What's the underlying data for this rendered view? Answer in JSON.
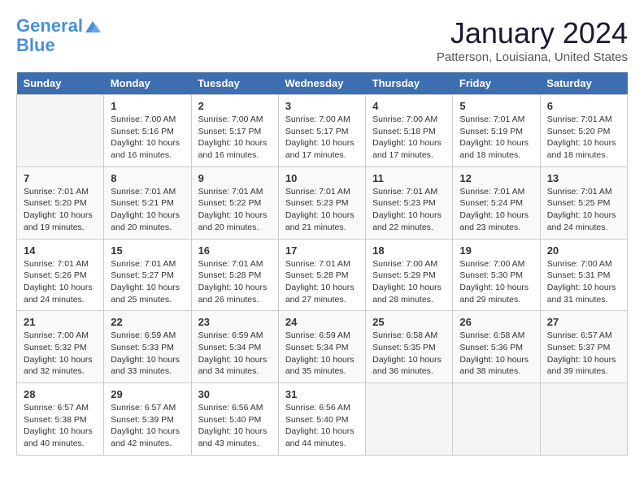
{
  "header": {
    "logo_line1": "General",
    "logo_line2": "Blue",
    "month_title": "January 2024",
    "location": "Patterson, Louisiana, United States"
  },
  "weekdays": [
    "Sunday",
    "Monday",
    "Tuesday",
    "Wednesday",
    "Thursday",
    "Friday",
    "Saturday"
  ],
  "weeks": [
    [
      {
        "day": "",
        "content": ""
      },
      {
        "day": "1",
        "content": "Sunrise: 7:00 AM\nSunset: 5:16 PM\nDaylight: 10 hours\nand 16 minutes."
      },
      {
        "day": "2",
        "content": "Sunrise: 7:00 AM\nSunset: 5:17 PM\nDaylight: 10 hours\nand 16 minutes."
      },
      {
        "day": "3",
        "content": "Sunrise: 7:00 AM\nSunset: 5:17 PM\nDaylight: 10 hours\nand 17 minutes."
      },
      {
        "day": "4",
        "content": "Sunrise: 7:00 AM\nSunset: 5:18 PM\nDaylight: 10 hours\nand 17 minutes."
      },
      {
        "day": "5",
        "content": "Sunrise: 7:01 AM\nSunset: 5:19 PM\nDaylight: 10 hours\nand 18 minutes."
      },
      {
        "day": "6",
        "content": "Sunrise: 7:01 AM\nSunset: 5:20 PM\nDaylight: 10 hours\nand 18 minutes."
      }
    ],
    [
      {
        "day": "7",
        "content": "Sunrise: 7:01 AM\nSunset: 5:20 PM\nDaylight: 10 hours\nand 19 minutes."
      },
      {
        "day": "8",
        "content": "Sunrise: 7:01 AM\nSunset: 5:21 PM\nDaylight: 10 hours\nand 20 minutes."
      },
      {
        "day": "9",
        "content": "Sunrise: 7:01 AM\nSunset: 5:22 PM\nDaylight: 10 hours\nand 20 minutes."
      },
      {
        "day": "10",
        "content": "Sunrise: 7:01 AM\nSunset: 5:23 PM\nDaylight: 10 hours\nand 21 minutes."
      },
      {
        "day": "11",
        "content": "Sunrise: 7:01 AM\nSunset: 5:23 PM\nDaylight: 10 hours\nand 22 minutes."
      },
      {
        "day": "12",
        "content": "Sunrise: 7:01 AM\nSunset: 5:24 PM\nDaylight: 10 hours\nand 23 minutes."
      },
      {
        "day": "13",
        "content": "Sunrise: 7:01 AM\nSunset: 5:25 PM\nDaylight: 10 hours\nand 24 minutes."
      }
    ],
    [
      {
        "day": "14",
        "content": "Sunrise: 7:01 AM\nSunset: 5:26 PM\nDaylight: 10 hours\nand 24 minutes."
      },
      {
        "day": "15",
        "content": "Sunrise: 7:01 AM\nSunset: 5:27 PM\nDaylight: 10 hours\nand 25 minutes."
      },
      {
        "day": "16",
        "content": "Sunrise: 7:01 AM\nSunset: 5:28 PM\nDaylight: 10 hours\nand 26 minutes."
      },
      {
        "day": "17",
        "content": "Sunrise: 7:01 AM\nSunset: 5:28 PM\nDaylight: 10 hours\nand 27 minutes."
      },
      {
        "day": "18",
        "content": "Sunrise: 7:00 AM\nSunset: 5:29 PM\nDaylight: 10 hours\nand 28 minutes."
      },
      {
        "day": "19",
        "content": "Sunrise: 7:00 AM\nSunset: 5:30 PM\nDaylight: 10 hours\nand 29 minutes."
      },
      {
        "day": "20",
        "content": "Sunrise: 7:00 AM\nSunset: 5:31 PM\nDaylight: 10 hours\nand 31 minutes."
      }
    ],
    [
      {
        "day": "21",
        "content": "Sunrise: 7:00 AM\nSunset: 5:32 PM\nDaylight: 10 hours\nand 32 minutes."
      },
      {
        "day": "22",
        "content": "Sunrise: 6:59 AM\nSunset: 5:33 PM\nDaylight: 10 hours\nand 33 minutes."
      },
      {
        "day": "23",
        "content": "Sunrise: 6:59 AM\nSunset: 5:34 PM\nDaylight: 10 hours\nand 34 minutes."
      },
      {
        "day": "24",
        "content": "Sunrise: 6:59 AM\nSunset: 5:34 PM\nDaylight: 10 hours\nand 35 minutes."
      },
      {
        "day": "25",
        "content": "Sunrise: 6:58 AM\nSunset: 5:35 PM\nDaylight: 10 hours\nand 36 minutes."
      },
      {
        "day": "26",
        "content": "Sunrise: 6:58 AM\nSunset: 5:36 PM\nDaylight: 10 hours\nand 38 minutes."
      },
      {
        "day": "27",
        "content": "Sunrise: 6:57 AM\nSunset: 5:37 PM\nDaylight: 10 hours\nand 39 minutes."
      }
    ],
    [
      {
        "day": "28",
        "content": "Sunrise: 6:57 AM\nSunset: 5:38 PM\nDaylight: 10 hours\nand 40 minutes."
      },
      {
        "day": "29",
        "content": "Sunrise: 6:57 AM\nSunset: 5:39 PM\nDaylight: 10 hours\nand 42 minutes."
      },
      {
        "day": "30",
        "content": "Sunrise: 6:56 AM\nSunset: 5:40 PM\nDaylight: 10 hours\nand 43 minutes."
      },
      {
        "day": "31",
        "content": "Sunrise: 6:56 AM\nSunset: 5:40 PM\nDaylight: 10 hours\nand 44 minutes."
      },
      {
        "day": "",
        "content": ""
      },
      {
        "day": "",
        "content": ""
      },
      {
        "day": "",
        "content": ""
      }
    ]
  ]
}
